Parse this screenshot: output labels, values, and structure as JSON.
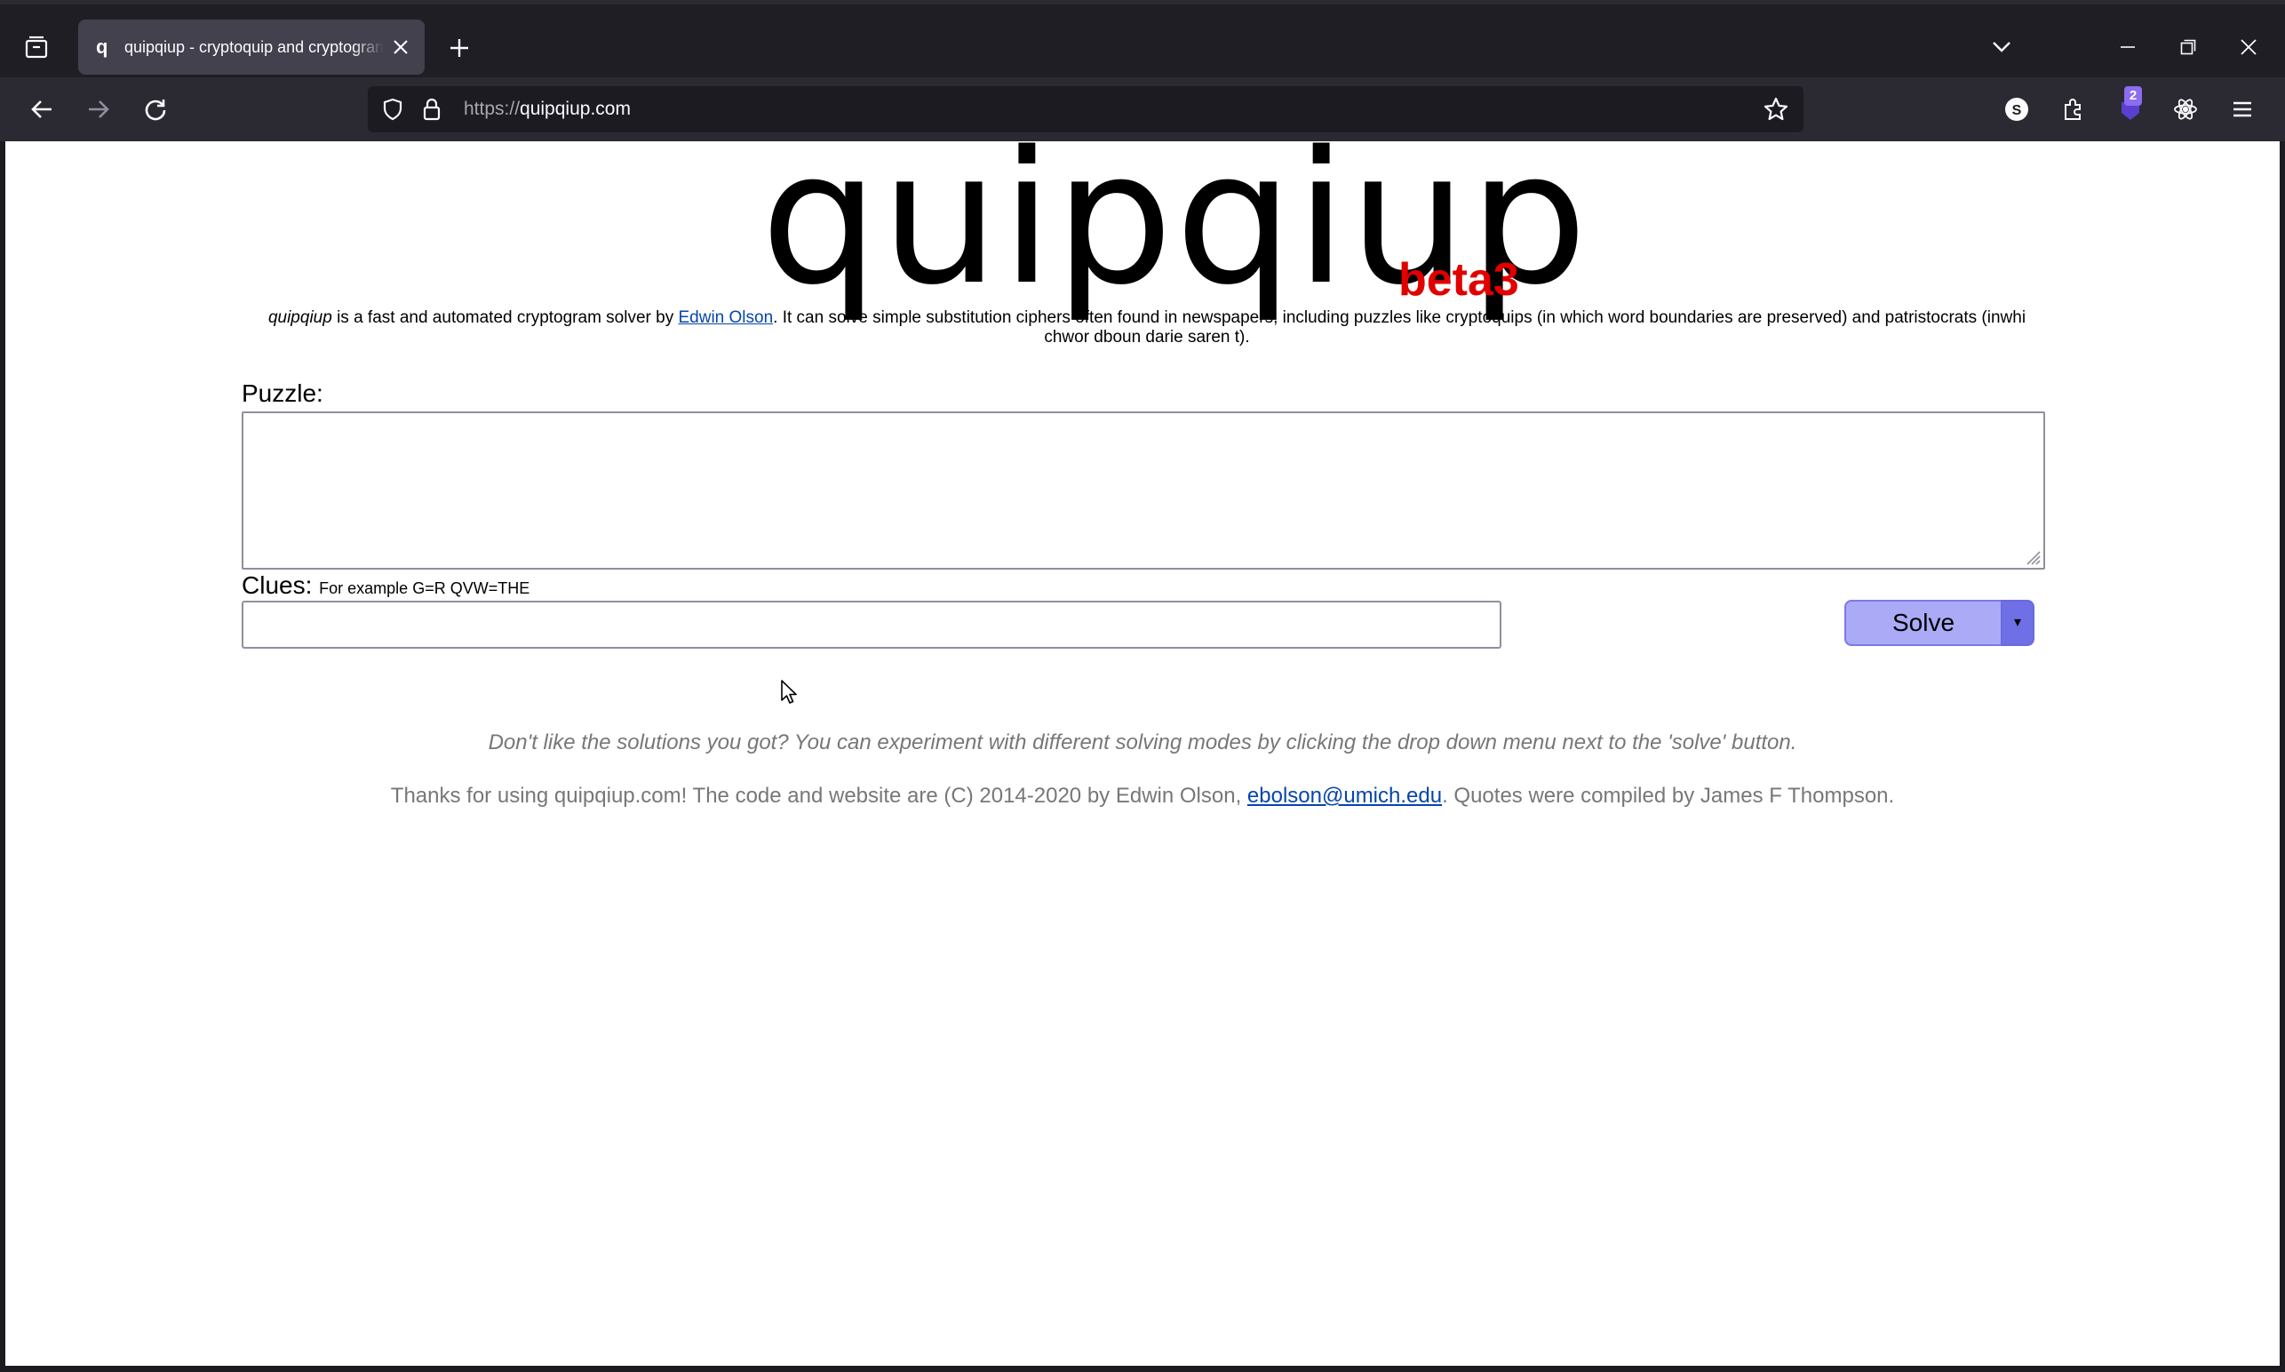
{
  "browser": {
    "tab_title": "quipqiup - cryptoquip and cryptogram solver",
    "tab_favicon": "q",
    "url_scheme": "https://",
    "url_host": "quipqiup.com",
    "extension_badge_count": "2",
    "icons": [
      "tab-list-icon",
      "close-tab-icon",
      "new-tab-icon",
      "list-all-tabs-icon",
      "minimize-icon",
      "restore-icon",
      "close-window-icon",
      "back-icon",
      "forward-icon",
      "reload-icon",
      "shield-icon",
      "lock-icon",
      "bookmark-star-icon",
      "account-icon",
      "extensions-icon",
      "extension-badge-icon",
      "react-devtools-icon",
      "menu-icon"
    ]
  },
  "page": {
    "logo_text": "quipqiup",
    "logo_beta": "beta3",
    "intro": {
      "brand": "quipqiup",
      "before_link": " is a fast and automated cryptogram solver by ",
      "author_link": "Edwin Olson",
      "after_link": ". It can solve simple substitution ciphers often found in newspapers, including puzzles like cryptoquips (in which word boundaries are preserved) and patristocrats (inwhi chwor dboun darie saren t)."
    },
    "puzzle_label": "Puzzle:",
    "puzzle_value": "",
    "clues_label": "Clues:",
    "clues_example": "For example G=R QVW=THE",
    "clues_value": "",
    "solve_label": "Solve",
    "solve_dropdown": "▾",
    "hint": "Don't like the solutions you got? You can experiment with different solving modes by clicking the drop down menu next to the 'solve' button.",
    "footer": {
      "before_link": "Thanks for using quipqiup.com! The code and website are (C) 2014-2020 by Edwin Olson, ",
      "email_link": "ebolson@umich.edu",
      "after_link": ". Quotes were compiled by James F Thompson."
    }
  },
  "colors": {
    "beta": "#e00000",
    "solve_button": "#aaaaf6",
    "solve_dropdown": "#6f6fe6",
    "link": "#0645ad",
    "muted_text": "#777777"
  }
}
